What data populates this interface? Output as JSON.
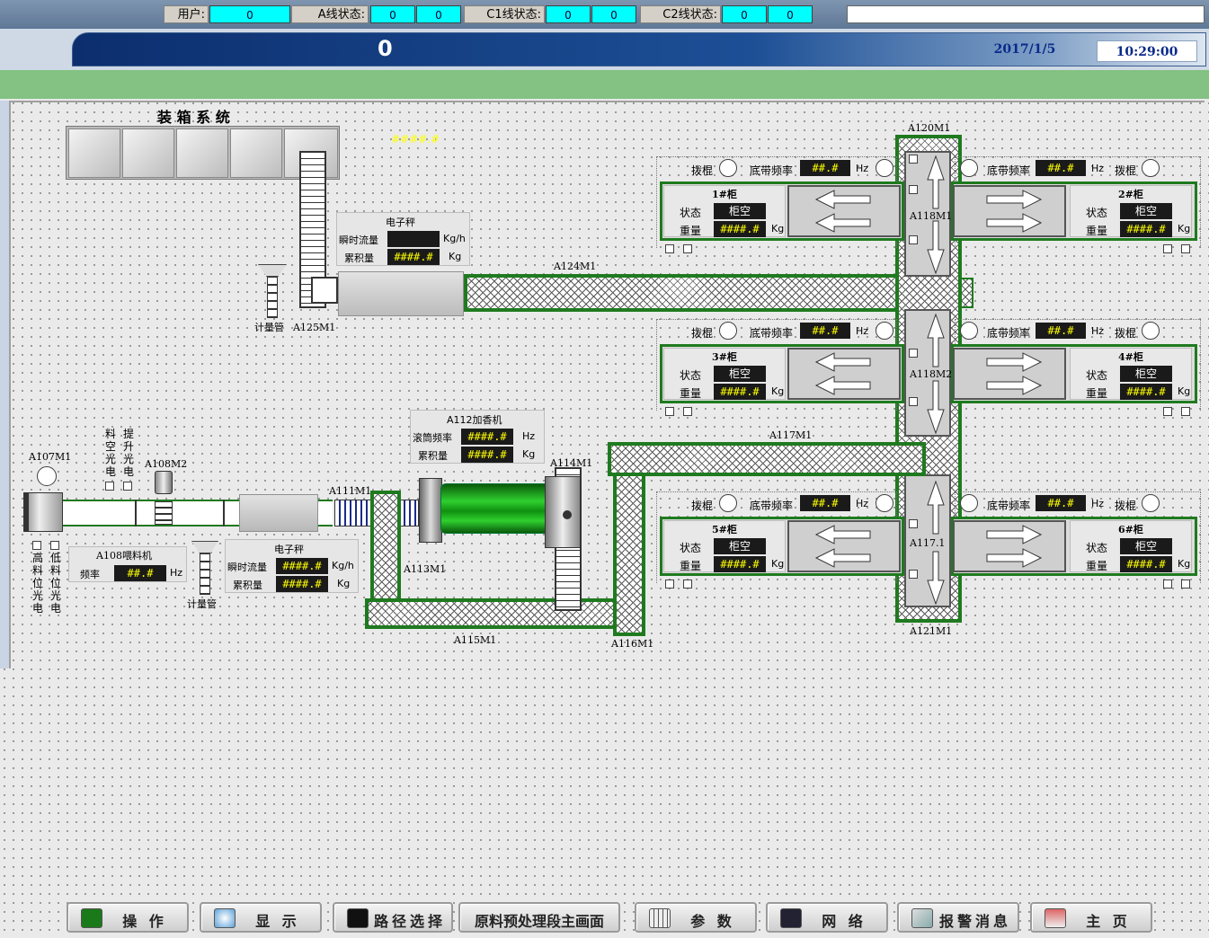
{
  "topbar": {
    "user_label": "用户:",
    "user_value": "0",
    "a_label": "A线状态:",
    "a_v1": "0",
    "a_v2": "0",
    "c1_label": "C1线状态:",
    "c1_v1": "0",
    "c1_v2": "0",
    "c2_label": "C2线状态:",
    "c2_v1": "0",
    "c2_v2": "0"
  },
  "header": {
    "value": "0",
    "date": "2017/1/5",
    "time": "10:29:00"
  },
  "packing": {
    "title": "装 箱 系 统",
    "hash": "####.#"
  },
  "scale1": {
    "title": "电子秤",
    "flow_label": "瞬时流量",
    "flow_unit": "Kg/h",
    "acc_label": "累积量",
    "acc_value": "####.#",
    "acc_unit": "Kg"
  },
  "scale2": {
    "title": "电子秤",
    "flow_label": "瞬时流量",
    "flow_value": "####.#",
    "flow_unit": "Kg/h",
    "acc_label": "累积量",
    "acc_value": "####.#",
    "acc_unit": "Kg"
  },
  "flavor": {
    "title": "A112加香机",
    "freq_label": "滚筒频率",
    "freq_value": "####.#",
    "freq_unit": "Hz",
    "acc_label": "累积量",
    "acc_value": "####.#",
    "acc_unit": "Kg"
  },
  "feeder": {
    "title": "A108喂料机",
    "freq_label": "频率",
    "freq_value": "##.#",
    "freq_unit": "Hz"
  },
  "labels": {
    "a125m1": "A125M1",
    "a124m1": "A124M1",
    "a120m1": "A120M1",
    "a121m1": "A121M1",
    "a118m1": "A118M1",
    "a118m2": "A118M2",
    "a117_1": "A117.1",
    "a117m1": "A117M1",
    "a107m1": "A107M1",
    "a108m2": "A108M2",
    "a111m1": "A111M1",
    "a113m1": "A113M1",
    "a114m1": "A114M1",
    "a115m1": "A115M1",
    "a116m1": "A116M1",
    "meter": "计量管",
    "meter2": "计量管",
    "empty_pe": "料空光电",
    "lift_pe": "提升光电",
    "high_pe": "高料位光电",
    "low_pe": "低料位光电"
  },
  "cabinets": [
    {
      "name": "1#柜",
      "state_label": "状态",
      "state": "柜空",
      "weight_label": "重量",
      "weight": "####.#",
      "weight_unit": "Kg",
      "roller": "拨棍",
      "belt_label": "底带频率",
      "belt": "##.#",
      "belt_unit": "Hz"
    },
    {
      "name": "2#柜",
      "state_label": "状态",
      "state": "柜空",
      "weight_label": "重量",
      "weight": "####.#",
      "weight_unit": "Kg",
      "roller": "拨棍",
      "belt_label": "底带频率",
      "belt": "##.#",
      "belt_unit": "Hz"
    },
    {
      "name": "3#柜",
      "state_label": "状态",
      "state": "柜空",
      "weight_label": "重量",
      "weight": "####.#",
      "weight_unit": "Kg",
      "roller": "拨棍",
      "belt_label": "底带频率",
      "belt": "##.#",
      "belt_unit": "Hz"
    },
    {
      "name": "4#柜",
      "state_label": "状态",
      "state": "柜空",
      "weight_label": "重量",
      "weight": "####.#",
      "weight_unit": "Kg",
      "roller": "拨棍",
      "belt_label": "底带频率",
      "belt": "##.#",
      "belt_unit": "Hz"
    },
    {
      "name": "5#柜",
      "state_label": "状态",
      "state": "柜空",
      "weight_label": "重量",
      "weight": "####.#",
      "weight_unit": "Kg",
      "roller": "拨棍",
      "belt_label": "底带频率",
      "belt": "##.#",
      "belt_unit": "Hz"
    },
    {
      "name": "6#柜",
      "state_label": "状态",
      "state": "柜空",
      "weight_label": "重量",
      "weight": "####.#",
      "weight_unit": "Kg",
      "roller": "拨棍",
      "belt_label": "底带频率",
      "belt": "##.#",
      "belt_unit": "Hz"
    }
  ],
  "buttons": [
    {
      "label": "操 作",
      "icon": "play-icon"
    },
    {
      "label": "显 示",
      "icon": "magnifier-icon"
    },
    {
      "label": "路径选择",
      "icon": "share-icon"
    },
    {
      "label": "原料预处理段主画面",
      "icon": ""
    },
    {
      "label": "参 数",
      "icon": "calculator-icon"
    },
    {
      "label": "网 络",
      "icon": "network-icon"
    },
    {
      "label": "报警消息",
      "icon": "notepad-icon"
    },
    {
      "label": "主 页",
      "icon": "home-icon"
    }
  ],
  "colors": {
    "cyan": "#00ffff",
    "green_bar": "#83c282",
    "process_green": "#1f7a1f",
    "value_yellow": "#ffff00"
  }
}
